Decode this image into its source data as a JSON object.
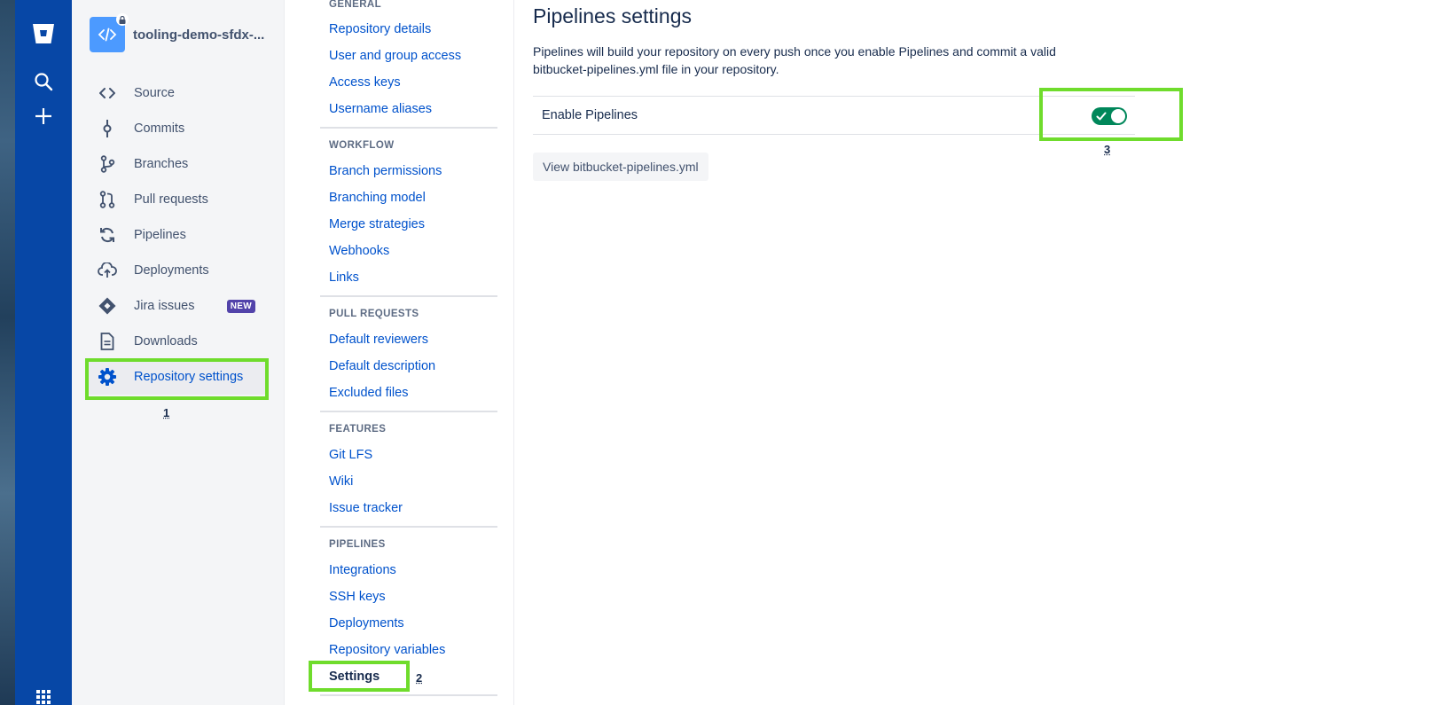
{
  "repo": {
    "name": "tooling-demo-sfdx-..."
  },
  "sidebar": {
    "items": [
      {
        "label": "Source",
        "icon": "code-icon"
      },
      {
        "label": "Commits",
        "icon": "commit-icon"
      },
      {
        "label": "Branches",
        "icon": "branch-icon"
      },
      {
        "label": "Pull requests",
        "icon": "pull-request-icon"
      },
      {
        "label": "Pipelines",
        "icon": "pipelines-icon"
      },
      {
        "label": "Deployments",
        "icon": "deployments-icon"
      },
      {
        "label": "Jira issues",
        "icon": "jira-icon",
        "badge": "NEW"
      },
      {
        "label": "Downloads",
        "icon": "downloads-icon"
      },
      {
        "label": "Repository settings",
        "icon": "gear-icon",
        "active": true
      }
    ]
  },
  "settings_nav": {
    "general": {
      "heading": "GENERAL",
      "links": [
        "Repository details",
        "User and group access",
        "Access keys",
        "Username aliases"
      ]
    },
    "workflow": {
      "heading": "WORKFLOW",
      "links": [
        "Branch permissions",
        "Branching model",
        "Merge strategies",
        "Webhooks",
        "Links"
      ]
    },
    "pull_requests": {
      "heading": "PULL REQUESTS",
      "links": [
        "Default reviewers",
        "Default description",
        "Excluded files"
      ]
    },
    "features": {
      "heading": "FEATURES",
      "links": [
        "Git LFS",
        "Wiki",
        "Issue tracker"
      ]
    },
    "pipelines": {
      "heading": "PIPELINES",
      "links": [
        "Integrations",
        "SSH keys",
        "Deployments",
        "Repository variables",
        "Settings"
      ]
    }
  },
  "main": {
    "title": "Pipelines settings",
    "description": "Pipelines will build your repository on every push once you enable Pipelines and commit a valid bitbucket-pipelines.yml file in your repository.",
    "enable_label": "Enable Pipelines",
    "enabled": true,
    "view_button": "View bitbucket-pipelines.yml"
  },
  "annotations": [
    "1",
    "2",
    "3"
  ],
  "colors": {
    "nav": "#0747a6",
    "link": "#0052cc",
    "toggle_on": "#00875a",
    "highlight": "#6fdc2c",
    "badge": "#5243aa"
  }
}
